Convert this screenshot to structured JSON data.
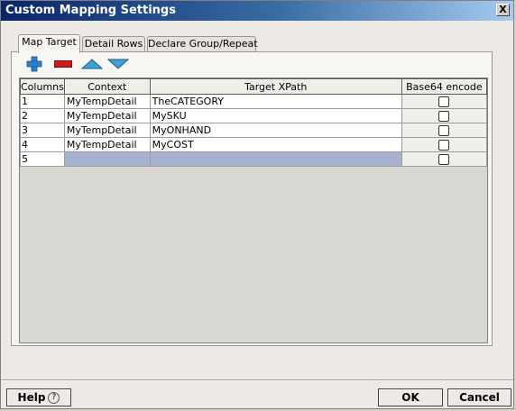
{
  "window": {
    "title": "Custom Mapping Settings",
    "close_glyph": "X"
  },
  "tabs": [
    {
      "label": "Map Target"
    },
    {
      "label": "Detail Rows"
    },
    {
      "label": "Declare Group/Repeat"
    }
  ],
  "toolbar": {
    "icons": [
      "add-icon",
      "remove-icon",
      "move-up-icon",
      "move-down-icon"
    ]
  },
  "table": {
    "headers": [
      "Columns",
      "Context",
      "Target XPath",
      "Base64 encode"
    ],
    "rows": [
      {
        "col": "1",
        "context": "MyTempDetail",
        "xpath": "TheCATEGORY",
        "base64": false
      },
      {
        "col": "2",
        "context": "MyTempDetail",
        "xpath": "MySKU",
        "base64": false
      },
      {
        "col": "3",
        "context": "MyTempDetail",
        "xpath": "MyONHAND",
        "base64": false
      },
      {
        "col": "4",
        "context": "MyTempDetail",
        "xpath": "MyCOST",
        "base64": false
      },
      {
        "col": "5",
        "context": "",
        "xpath": "",
        "base64": false
      }
    ]
  },
  "footer": {
    "help_label": "Help",
    "help_glyph": "?",
    "ok_label": "OK",
    "cancel_label": "Cancel"
  },
  "colors": {
    "title_start": "#0a246a",
    "selection": "#a6b0cf"
  }
}
